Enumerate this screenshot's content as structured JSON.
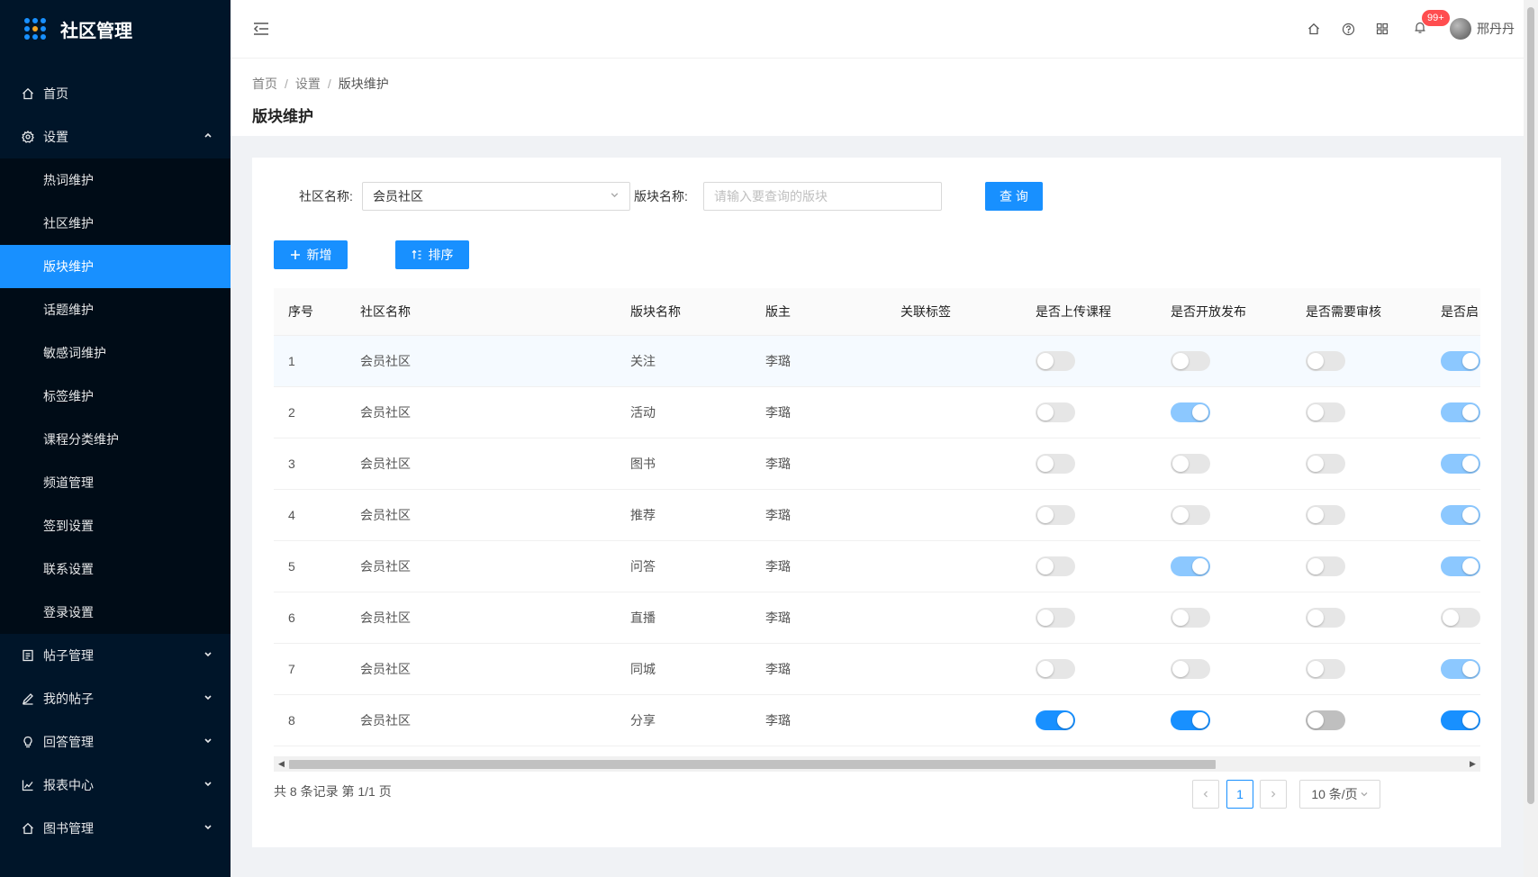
{
  "app": {
    "title": "社区管理"
  },
  "colors": {
    "sidebar_bg": "#001529",
    "accent": "#1890ff",
    "badge": "#ff4d4f"
  },
  "sidebar": {
    "top": [
      {
        "label": "首页",
        "icon": "home-icon"
      }
    ],
    "settings": {
      "label": "设置",
      "icon": "gear-icon",
      "expanded": true,
      "children": [
        "热词维护",
        "社区维护",
        "版块维护",
        "话题维护",
        "敏感词维护",
        "标签维护",
        "课程分类维护",
        "频道管理",
        "签到设置",
        "联系设置",
        "登录设置"
      ],
      "active": "版块维护"
    },
    "bottom": [
      {
        "label": "帖子管理",
        "icon": "file-list-icon"
      },
      {
        "label": "我的帖子",
        "icon": "pencil-icon"
      },
      {
        "label": "回答管理",
        "icon": "bulb-icon"
      },
      {
        "label": "报表中心",
        "icon": "line-chart-icon"
      },
      {
        "label": "图书管理",
        "icon": "home-icon"
      }
    ]
  },
  "header": {
    "notification_badge": "99+",
    "username": "邢丹丹"
  },
  "breadcrumb": {
    "items": [
      "首页",
      "设置",
      "版块维护"
    ]
  },
  "page_title": "版块维护",
  "search": {
    "community_label": "社区名称:",
    "community_value": "会员社区",
    "block_label": "版块名称:",
    "block_placeholder": "请输入要查询的版块",
    "query_button": "查 询"
  },
  "toolbar": {
    "add_label": "新增",
    "sort_label": "排序"
  },
  "table": {
    "columns": [
      "序号",
      "社区名称",
      "版块名称",
      "版主",
      "关联标签",
      "是否上传课程",
      "是否开放发布",
      "是否需要审核",
      "是否启"
    ],
    "rows": [
      {
        "index": "1",
        "community": "会员社区",
        "block": "关注",
        "moderator": "李璐",
        "tags": "",
        "upload": false,
        "publish": false,
        "review": false,
        "enabled": true
      },
      {
        "index": "2",
        "community": "会员社区",
        "block": "活动",
        "moderator": "李璐",
        "tags": "",
        "upload": false,
        "publish": true,
        "review": false,
        "enabled": true
      },
      {
        "index": "3",
        "community": "会员社区",
        "block": "图书",
        "moderator": "李璐",
        "tags": "",
        "upload": false,
        "publish": false,
        "review": false,
        "enabled": true
      },
      {
        "index": "4",
        "community": "会员社区",
        "block": "推荐",
        "moderator": "李璐",
        "tags": "",
        "upload": false,
        "publish": false,
        "review": false,
        "enabled": true
      },
      {
        "index": "5",
        "community": "会员社区",
        "block": "问答",
        "moderator": "李璐",
        "tags": "",
        "upload": false,
        "publish": true,
        "review": false,
        "enabled": true
      },
      {
        "index": "6",
        "community": "会员社区",
        "block": "直播",
        "moderator": "李璐",
        "tags": "",
        "upload": false,
        "publish": false,
        "review": false,
        "enabled": false
      },
      {
        "index": "7",
        "community": "会员社区",
        "block": "同城",
        "moderator": "李璐",
        "tags": "",
        "upload": false,
        "publish": false,
        "review": false,
        "enabled": true
      },
      {
        "index": "8",
        "community": "会员社区",
        "block": "分享",
        "moderator": "李璐",
        "tags": "",
        "upload": true,
        "publish": true,
        "review": false,
        "enabled": true
      }
    ]
  },
  "pagination": {
    "summary": "共 8 条记录 第 1/1 页",
    "current": "1",
    "page_size": "10 条/页"
  }
}
